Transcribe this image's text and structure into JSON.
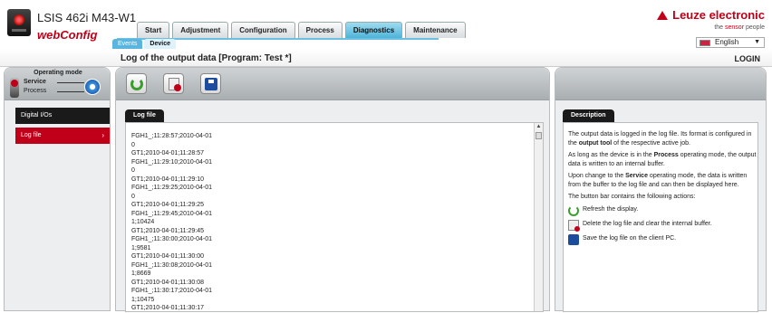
{
  "header": {
    "device_name": "LSIS 462i M43-W1",
    "app_name": "webConfig",
    "brand": "Leuze electronic",
    "tagline_prefix": "the ",
    "tagline_accent": "sensor",
    "tagline_suffix": " people",
    "language": "English"
  },
  "main_tabs": [
    "Start",
    "Adjustment",
    "Configuration",
    "Process",
    "Diagnostics",
    "Maintenance"
  ],
  "active_main_tab": "Diagnostics",
  "sub_tabs": [
    "Events",
    "Device"
  ],
  "active_sub_tab": "Device",
  "title_bar": {
    "title": "Log of the output data   [Program: Test *]",
    "login": "LOGIN"
  },
  "operating_mode": {
    "title": "Operating mode",
    "service": "Service",
    "process": "Process"
  },
  "nav": [
    {
      "label": "Digital I/Os"
    },
    {
      "label": "Log file",
      "arrow": "›"
    }
  ],
  "toolbar": {
    "refresh_icon": "refresh-icon",
    "delete_icon": "delete-log-icon",
    "save_icon": "save-icon"
  },
  "log": {
    "tab_label": "Log file",
    "lines": [
      "FGH1_;11:28:57;2010-04-01",
      "0",
      "GT1;2010-04-01;11:28:57",
      "FGH1_;11:29:10;2010-04-01",
      "0",
      "GT1;2010-04-01;11:29:10",
      "FGH1_;11:29:25;2010-04-01",
      "0",
      "GT1;2010-04-01;11:29:25",
      "FGH1_;11:29:45;2010-04-01",
      "1;10424",
      "GT1;2010-04-01;11:29:45",
      "FGH1_;11:30:00;2010-04-01",
      "1;9581",
      "GT1;2010-04-01;11:30:00",
      "FGH1_;11:30:08;2010-04-01",
      "1;8669",
      "GT1;2010-04-01;11:30:08",
      "FGH1_;11:30:17;2010-04-01",
      "1;10475",
      "GT1;2010-04-01;11:30:17"
    ]
  },
  "description": {
    "tab_label": "Description",
    "p1_a": "The output data is logged in the log file. Its format is configured in the ",
    "p1_b": "output tool",
    "p1_c": " of the respective active job.",
    "p2_a": "As long as the device is in the ",
    "p2_b": "Process",
    "p2_c": " operating mode, the output data is written to an internal buffer.",
    "p3_a": "Upon change to the ",
    "p3_b": "Service",
    "p3_c": " operating mode, the data is written from the buffer to the log file and can then be displayed here.",
    "p4": "The button bar contains the following actions:",
    "action_refresh": "Refresh the display.",
    "action_delete": "Delete the log file and clear the internal buffer.",
    "action_save": "Save the log file on the client PC."
  }
}
